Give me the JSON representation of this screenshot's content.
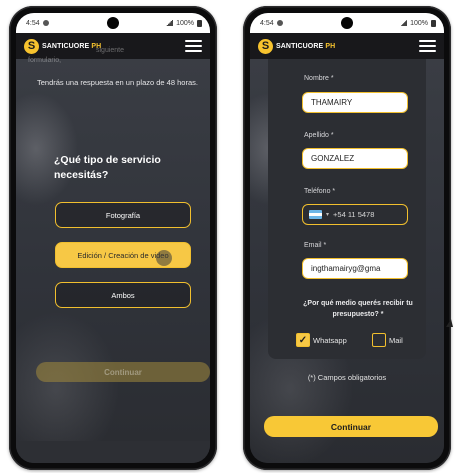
{
  "left_phone": {
    "status": {
      "time": "4:54",
      "battery": "100%"
    },
    "brand": {
      "name": "SANTICUORE",
      "suffix": "PH"
    },
    "ghost_text": "formulario,",
    "ghost_text_2": "siguiente",
    "intro": "Tendrás una respuesta en un plazo de 48 horas.",
    "question": "¿Qué tipo de servicio necesitás?",
    "options": [
      {
        "label": "Fotografía",
        "selected": false
      },
      {
        "label": "Edición / Creación de video",
        "selected": true
      },
      {
        "label": "Ambos",
        "selected": false
      }
    ],
    "continue_label": "Continuar"
  },
  "right_phone": {
    "status": {
      "time": "4:54",
      "battery": "100%"
    },
    "brand": {
      "name": "SANTICUORE",
      "suffix": "PH"
    },
    "fields": {
      "nombre": {
        "label": "Nombre *",
        "value": "THAMAIRY"
      },
      "apellido": {
        "label": "Apellido *",
        "value": "GONZALEZ"
      },
      "telefono": {
        "label": "Teléfono *",
        "value": "+54 11 5478"
      },
      "email": {
        "label": "Email *",
        "value": "ingthamairyg@gma"
      }
    },
    "budget_question": "¿Por qué medio querés recibir tu presupuesto? *",
    "channels": [
      {
        "label": "Whatsapp",
        "checked": true
      },
      {
        "label": "Mail",
        "checked": false
      }
    ],
    "required_note": "(*) Campos obligatorios",
    "continue_label": "Continuar"
  },
  "colors": {
    "accent": "#f7c32e",
    "dark": "#24262a"
  },
  "icons": [
    "menu-icon",
    "check-icon",
    "argentina-flag-icon",
    "signal-icon",
    "battery-icon"
  ]
}
